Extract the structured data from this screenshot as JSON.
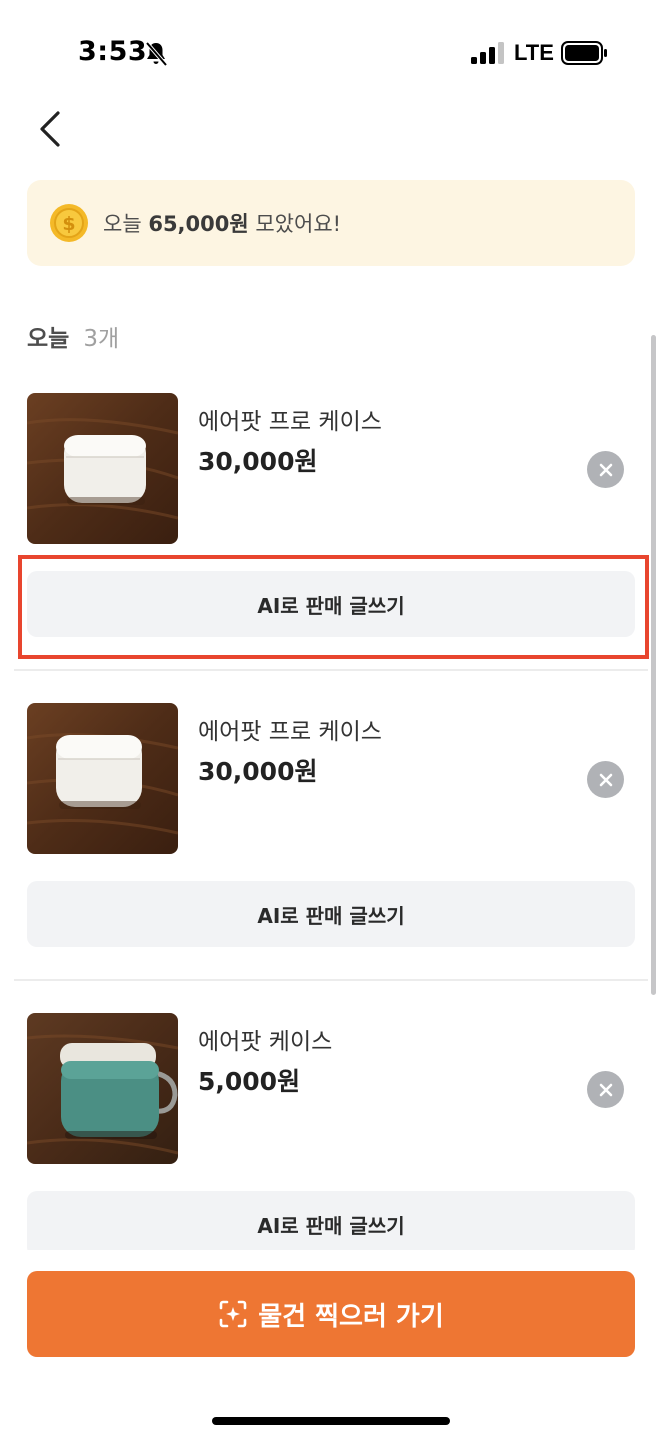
{
  "status_bar": {
    "time": "3:53",
    "network": "LTE",
    "bell_icon": "bell-slash-icon",
    "signal_icon": "cellular-signal-icon",
    "battery_icon": "battery-full-icon"
  },
  "nav": {
    "back_icon": "chevron-left-icon"
  },
  "banner": {
    "icon": "coin-dollar-icon",
    "prefix": "오늘 ",
    "amount": "65,000원",
    "suffix": " 모았어요!"
  },
  "section": {
    "title": "오늘",
    "count": "3개"
  },
  "items": [
    {
      "name": "에어팟 프로 케이스",
      "price": "30,000원",
      "action_label": "AI로 판매 글쓰기",
      "image": "white-airpods-pro-case-photo",
      "highlighted": true
    },
    {
      "name": "에어팟 프로 케이스",
      "price": "30,000원",
      "action_label": "AI로 판매 글쓰기",
      "image": "white-airpods-pro-case-photo",
      "highlighted": false
    },
    {
      "name": "에어팟 케이스",
      "price": "5,000원",
      "action_label": "AI로 판매 글쓰기",
      "image": "green-airpods-silicone-case-photo",
      "highlighted": false
    }
  ],
  "cta": {
    "icon": "camera-sparkle-icon",
    "label": "물건 찍으러 가기"
  },
  "colors": {
    "accent": "#ee7633",
    "banner_bg": "#fdf5e2",
    "highlight_border": "#e8452e",
    "button_bg": "#f2f3f5"
  }
}
